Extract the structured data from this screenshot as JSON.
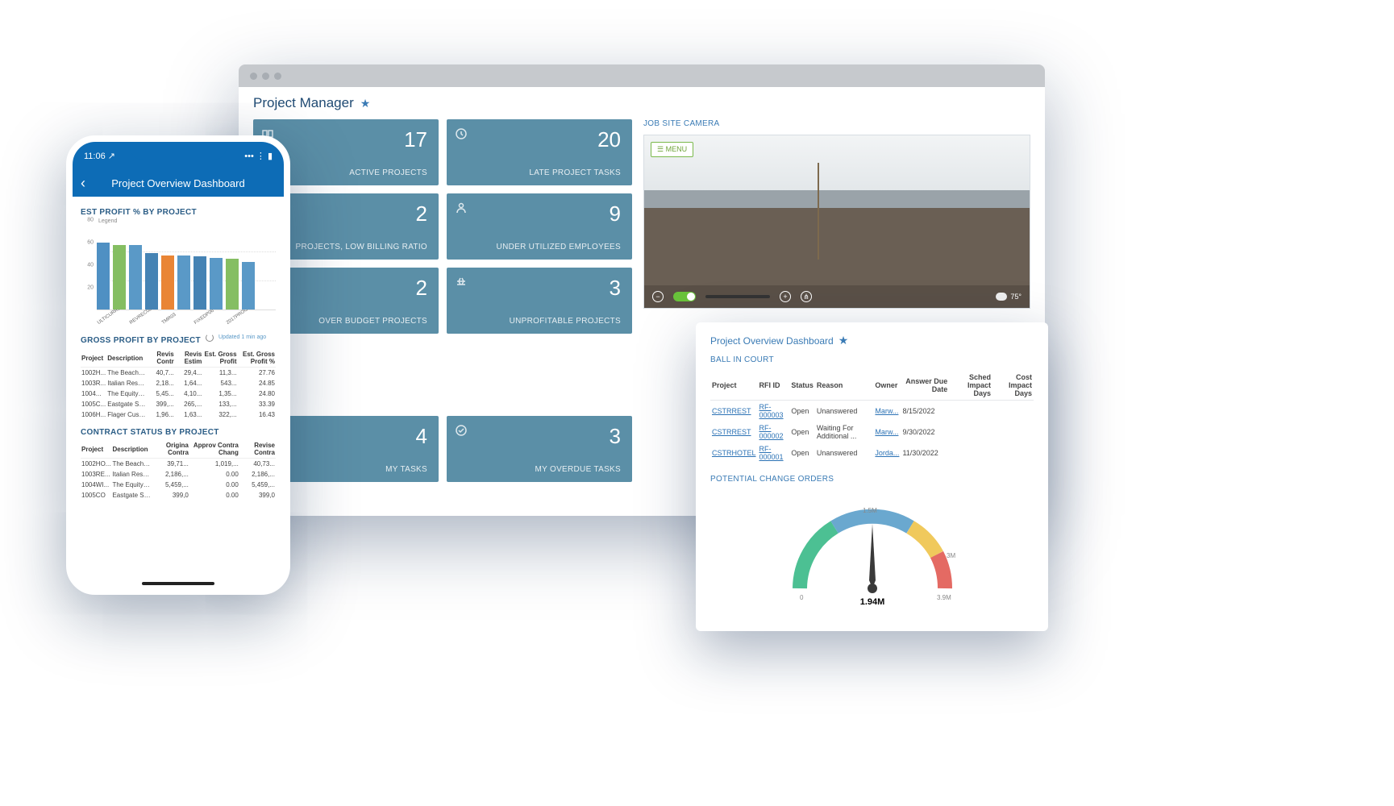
{
  "browser": {
    "title": "Project Manager",
    "tiles": [
      {
        "num": "17",
        "label": "ACTIVE PROJECTS",
        "icon": "projects-icon"
      },
      {
        "num": "20",
        "label": "LATE PROJECT TASKS",
        "icon": "clock-icon"
      },
      {
        "num": "2",
        "label": "PROJECTS, LOW BILLING RATIO",
        "icon": "ratio-icon"
      },
      {
        "num": "9",
        "label": "UNDER UTILIZED EMPLOYEES",
        "icon": "person-icon"
      },
      {
        "num": "2",
        "label": "OVER BUDGET PROJECTS",
        "icon": "budget-icon"
      },
      {
        "num": "3",
        "label": "UNPROFITABLE PROJECTS",
        "icon": "unprofitable-icon"
      },
      {
        "num": "4",
        "label": "MY TASKS",
        "icon": "tasks-icon"
      },
      {
        "num": "3",
        "label": "MY OVERDUE TASKS",
        "icon": "check-icon"
      }
    ],
    "camera": {
      "title": "JOB SITE CAMERA",
      "menu": "☰ MENU",
      "temp": "75°"
    }
  },
  "float": {
    "title": "Project Overview Dashboard",
    "ball_in_court": {
      "heading": "BALL IN COURT",
      "cols": [
        "Project",
        "RFI ID",
        "Status",
        "Reason",
        "Owner",
        "Answer Due Date",
        "Sched Impact Days",
        "Cost Impact Days"
      ],
      "rows": [
        {
          "project": "CSTRREST",
          "rfi": "RF-000003",
          "status": "Open",
          "reason": "Unanswered",
          "owner": "Marw...",
          "due": "8/15/2022"
        },
        {
          "project": "CSTRREST",
          "rfi": "RF-000002",
          "status": "Open",
          "reason": "Waiting For Additional ...",
          "owner": "Marw...",
          "due": "9/30/2022"
        },
        {
          "project": "CSTRHOTEL",
          "rfi": "RF-000001",
          "status": "Open",
          "reason": "Unanswered",
          "owner": "Jorda...",
          "due": "11/30/2022"
        }
      ]
    },
    "gauge": {
      "heading": "POTENTIAL CHANGE ORDERS",
      "value_label": "1.94M",
      "ticks": {
        "min": "0",
        "mid1": "1.5M",
        "mid2": "3M",
        "max": "3.9M"
      }
    }
  },
  "phone": {
    "status_time": "11:06 ↗",
    "header_title": "Project Overview Dashboard",
    "est_profit_heading": "EST PROFIT % BY PROJECT",
    "legend": "Legend",
    "gross_profit_heading": "GROSS PROFIT BY PROJECT",
    "updated": "Updated 1 min ago",
    "gp_cols": [
      "Project",
      "Description",
      "Revis Contr",
      "Revis Estim",
      "Est. Gross Profit",
      "Est. Gross Profit %"
    ],
    "gp_rows": [
      {
        "p": "1002H...",
        "d": "The Beach Hot...",
        "c": "40,7...",
        "e": "29,4...",
        "g": "11,3...",
        "pc": "27.76"
      },
      {
        "p": "1003R...",
        "d": "Italian Restaura...",
        "c": "2,18...",
        "e": "1,64...",
        "g": "543...",
        "pc": "24.85"
      },
      {
        "p": "1004...",
        "d": "The Equity Gro...",
        "c": "5,45...",
        "e": "4,10...",
        "g": "1,35...",
        "pc": "24.80"
      },
      {
        "p": "1005C...",
        "d": "Eastgate Strip ...",
        "c": "399,...",
        "e": "265,...",
        "g": "133,...",
        "pc": "33.39"
      },
      {
        "p": "1006H...",
        "d": "Flager Custom ...",
        "c": "1,96...",
        "e": "1,63...",
        "g": "322,...",
        "pc": "16.43"
      }
    ],
    "contract_heading": "CONTRACT STATUS BY PROJECT",
    "cs_cols": [
      "Project",
      "Description",
      "Origina Contra",
      "Approv Contra Chang",
      "Revise Contra"
    ],
    "cs_rows": [
      {
        "p": "1002HO...",
        "d": "The Beach Hotel a...",
        "o": "39,71...",
        "a": "1,019,...",
        "r": "40,73..."
      },
      {
        "p": "1003RE...",
        "d": "Italian Restaurant ...",
        "o": "2,186,...",
        "a": "0.00",
        "r": "2,186,..."
      },
      {
        "p": "1004WI...",
        "d": "The Equity Group -...",
        "o": "5,459,...",
        "a": "0.00",
        "r": "5,459,..."
      },
      {
        "p": "1005CO",
        "d": "Eastgate Strip Mall",
        "o": "399,0",
        "a": "0.00",
        "r": "399,0"
      }
    ]
  },
  "chart_data": {
    "type": "bar",
    "title": "EST PROFIT % BY PROJECT",
    "ylabel": "",
    "ylim": [
      0,
      80
    ],
    "yticks": [
      20,
      40,
      60,
      80
    ],
    "categories": [
      "ULTICURR1",
      "",
      "REVREC02",
      "",
      "TMR03",
      "",
      "FIXEDP06",
      "",
      "2017PROG01",
      ""
    ],
    "values": [
      62,
      60,
      60,
      52,
      50,
      50,
      49,
      48,
      47,
      44
    ],
    "colors": [
      "#4f90c3",
      "#85be62",
      "#5a99c7",
      "#4583b4",
      "#e98535",
      "#5a99c7",
      "#4583b4",
      "#5a99c7",
      "#85be62",
      "#5a99c7"
    ]
  }
}
